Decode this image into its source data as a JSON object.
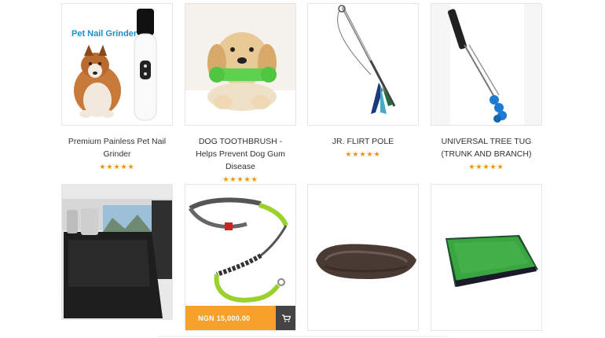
{
  "products": [
    {
      "title": "Premium Painless Pet Nail Grinder",
      "stars": "★★★★★",
      "image_label": "Pet Nail Grinder"
    },
    {
      "title": "DOG TOOTHBRUSH - Helps Prevent Dog Gum Disease",
      "stars": "★★★★★"
    },
    {
      "title": "JR. FLIRT POLE",
      "stars": "★★★★★"
    },
    {
      "title": "UNIVERSAL TREE TUG (TRUNK AND BRANCH)",
      "stars": "★★★★★"
    }
  ],
  "row2": {
    "price": "NGN 15,000.00",
    "cart_icon": "cart-icon",
    "accent_color": "#f6a12a"
  }
}
